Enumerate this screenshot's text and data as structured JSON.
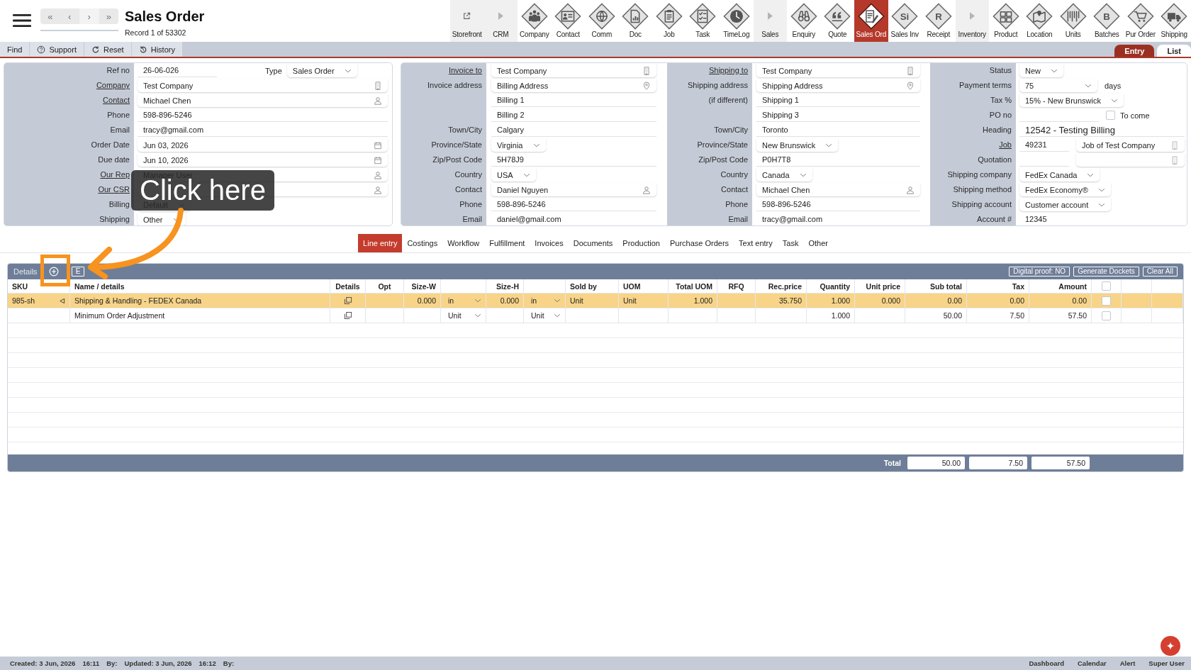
{
  "header": {
    "nav_buttons": [
      "«",
      "‹",
      "›",
      "»"
    ],
    "title": "Sales Order",
    "record": "Record 1 of 53302"
  },
  "modules": [
    {
      "label": "Storefront",
      "kind": "link",
      "selected": false
    },
    {
      "label": "CRM",
      "kind": "section",
      "selected": false
    },
    {
      "label": "Company",
      "kind": "module",
      "selected": false
    },
    {
      "label": "Contact",
      "kind": "module",
      "selected": false
    },
    {
      "label": "Comm",
      "kind": "module",
      "selected": false
    },
    {
      "label": "Doc",
      "kind": "module",
      "selected": false
    },
    {
      "label": "Job",
      "kind": "module",
      "selected": false
    },
    {
      "label": "Task",
      "kind": "module",
      "selected": false
    },
    {
      "label": "TimeLog",
      "kind": "module",
      "selected": false
    },
    {
      "label": "Sales",
      "kind": "section",
      "selected": false
    },
    {
      "label": "Enquiry",
      "kind": "module",
      "selected": false
    },
    {
      "label": "Quote",
      "kind": "module",
      "selected": false
    },
    {
      "label": "Sales Ord",
      "kind": "module",
      "selected": true
    },
    {
      "label": "Sales Inv",
      "kind": "module",
      "glyph": "Si",
      "selected": false
    },
    {
      "label": "Receipt",
      "kind": "module",
      "glyph": "R",
      "selected": false
    },
    {
      "label": "Inventory",
      "kind": "section",
      "selected": false
    },
    {
      "label": "Product",
      "kind": "module",
      "selected": false
    },
    {
      "label": "Location",
      "kind": "module",
      "selected": false
    },
    {
      "label": "Units",
      "kind": "module",
      "selected": false
    },
    {
      "label": "Batches",
      "kind": "module",
      "glyph": "B",
      "selected": false
    },
    {
      "label": "Pur Order",
      "kind": "module",
      "selected": false
    },
    {
      "label": "Shipping",
      "kind": "module",
      "selected": false
    }
  ],
  "toolbar": {
    "buttons": [
      "Find",
      "Support",
      "Reset",
      "History"
    ],
    "view_tabs": [
      {
        "label": "Entry",
        "selected": true
      },
      {
        "label": "List",
        "selected": false
      }
    ]
  },
  "form": {
    "panels": [
      {
        "sections": [
          {
            "rows": [
              {
                "label": "Ref no",
                "link": false,
                "value": "26-06-026",
                "kind": "text",
                "extra": {
                  "kind": "select",
                  "label": "Type",
                  "value": "Sales Order"
                }
              },
              {
                "label": "Company",
                "link": true,
                "value": "Test Company",
                "kind": "company"
              },
              {
                "label": "Contact",
                "link": true,
                "value": "Michael Chen",
                "kind": "person"
              },
              {
                "label": "Phone",
                "link": false,
                "value": "598-896-5246",
                "kind": "text"
              },
              {
                "label": "Email",
                "link": false,
                "value": "tracy@gmail.com",
                "kind": "text"
              },
              {
                "label": "Order Date",
                "link": false,
                "value": "Jun 03, 2026",
                "kind": "date"
              },
              {
                "label": "Due date",
                "link": false,
                "value": "Jun 10, 2026",
                "kind": "date"
              },
              {
                "label": "Our Rep",
                "link": true,
                "value": "Manager User",
                "kind": "person"
              },
              {
                "label": "Our CSR",
                "link": true,
                "kind": "person"
              },
              {
                "label": "Billing",
                "link": false,
                "value": "Default",
                "kind": "select"
              },
              {
                "label": "Shipping",
                "link": false,
                "value": "Other",
                "kind": "select"
              }
            ]
          }
        ]
      },
      {
        "sections": [
          {
            "rows": [
              {
                "label": "Invoice to",
                "link": true,
                "value": "Test Company",
                "kind": "company"
              },
              {
                "label": "Invoice address",
                "link": false,
                "value": "Billing Address",
                "kind": "address"
              },
              {
                "value": "Billing 1",
                "kind": "text"
              },
              {
                "value": "Billing 2",
                "kind": "text"
              },
              {
                "label": "Town/City",
                "link": false,
                "value": "Calgary",
                "kind": "text"
              },
              {
                "label": "Province/State",
                "link": false,
                "value": "Virginia",
                "kind": "select"
              },
              {
                "label": "Zip/Post Code",
                "link": false,
                "value": "5H78J9",
                "kind": "text"
              },
              {
                "label": "Country",
                "link": false,
                "value": "USA",
                "kind": "select"
              },
              {
                "label": "Contact",
                "link": false,
                "value": "Daniel Nguyen",
                "kind": "person"
              },
              {
                "label": "Phone",
                "link": false,
                "value": "598-896-5246",
                "kind": "text"
              },
              {
                "label": "Email",
                "link": false,
                "value": "daniel@gmail.com",
                "kind": "text"
              }
            ]
          },
          {
            "rows": [
              {
                "label": "Shipping to",
                "link": true,
                "value": "Test Company",
                "kind": "company"
              },
              {
                "label": "Shipping address",
                "link": false,
                "value": "Shipping Address",
                "kind": "address"
              },
              {
                "label": "(if different)",
                "link": false,
                "value": "Shipping 1",
                "kind": "text"
              },
              {
                "value": "Shipping 3",
                "kind": "text"
              },
              {
                "label": "Town/City",
                "link": false,
                "value": "Toronto",
                "kind": "text"
              },
              {
                "label": "Province/State",
                "link": false,
                "value": "New Brunswick",
                "kind": "select"
              },
              {
                "label": "Zip/Post Code",
                "link": false,
                "value": "P0H7T8",
                "kind": "text"
              },
              {
                "label": "Country",
                "link": false,
                "value": "Canada",
                "kind": "select"
              },
              {
                "label": "Contact",
                "link": false,
                "value": "Michael Chen",
                "kind": "person"
              },
              {
                "label": "Phone",
                "link": false,
                "value": "598-896-5246",
                "kind": "text"
              },
              {
                "label": "Email",
                "link": false,
                "value": "tracy@gmail.com",
                "kind": "text"
              }
            ]
          },
          {
            "rows": [
              {
                "label": "Status",
                "link": false,
                "value": "New",
                "kind": "select"
              },
              {
                "label": "Payment terms",
                "link": false,
                "value": "75",
                "kind": "select",
                "suffix": "days"
              },
              {
                "label": "Tax %",
                "link": false,
                "value": "15% - New Brunswick",
                "kind": "select"
              },
              {
                "label": "PO no",
                "link": false,
                "kind": "text",
                "extra": {
                  "kind": "checkbox",
                  "label": "To come",
                  "checked": false
                }
              },
              {
                "label": "Heading",
                "link": false,
                "value": "12542 - Testing Billing",
                "kind": "heading"
              },
              {
                "label": "Job",
                "link": true,
                "value": "49231",
                "kind": "text",
                "extra": {
                  "kind": "lookup",
                  "value": "Job of Test Company"
                }
              },
              {
                "label": "Quotation",
                "link": false,
                "kind": "text",
                "extra": {
                  "kind": "lookup"
                }
              },
              {
                "label": "Shipping company",
                "link": false,
                "value": "FedEx Canada",
                "kind": "select"
              },
              {
                "label": "Shipping method",
                "link": false,
                "value": "FedEx Economy®",
                "kind": "select"
              },
              {
                "label": "Shipping account",
                "link": false,
                "value": "Customer account",
                "kind": "select"
              },
              {
                "label": "Account #",
                "link": false,
                "value": "12345",
                "kind": "text"
              }
            ]
          }
        ]
      }
    ]
  },
  "tabs": [
    {
      "label": "Line entry",
      "selected": true
    },
    {
      "label": "Costings",
      "selected": false
    },
    {
      "label": "Workflow",
      "selected": false
    },
    {
      "label": "Fulfillment",
      "selected": false
    },
    {
      "label": "Invoices",
      "selected": false
    },
    {
      "label": "Documents",
      "selected": false
    },
    {
      "label": "Production",
      "selected": false
    },
    {
      "label": "Purchase Orders",
      "selected": false
    },
    {
      "label": "Text entry",
      "selected": false
    },
    {
      "label": "Task",
      "selected": false
    },
    {
      "label": "Other",
      "selected": false
    }
  ],
  "details": {
    "title": "Details",
    "left_buttons": [
      "E"
    ],
    "right_buttons": [
      "Digital proof: NO",
      "Generate Dockets",
      "Clear All"
    ],
    "columns": [
      "SKU",
      "Name / details",
      "Details",
      "Opt",
      "Size-W",
      "Size-H",
      "Sold by",
      "UOM",
      "Total UOM",
      "RFQ",
      "Rec.price",
      "Quantity",
      "Unit price",
      "Sub total",
      "Tax",
      "Amount"
    ],
    "all_checked": false,
    "rows": [
      {
        "selected": true,
        "checked": false,
        "sku": "985-sh",
        "name": "Shipping & Handling - FEDEX Canada",
        "size_w": "0.000",
        "size_w_unit": "in",
        "size_h": "0.000",
        "size_h_unit": "in",
        "sold_by": "Unit",
        "uom": "Unit",
        "total_uom": "1.000",
        "rec_price": "35.750",
        "quantity": "1.000",
        "unit_price": "0.000",
        "sub_total": "0.00",
        "tax": "0.00",
        "amount": "0.00"
      },
      {
        "selected": false,
        "checked": false,
        "name": "Minimum Order Adjustment",
        "size_w_unit": "Unit",
        "size_h_unit": "Unit",
        "quantity": "1.000",
        "sub_total": "50.00",
        "tax": "7.50",
        "amount": "57.50"
      }
    ],
    "totals": {
      "label": "Total",
      "sub_total": "50.00",
      "tax": "7.50",
      "amount": "57.50"
    }
  },
  "callout": {
    "text": "Click here"
  },
  "status_bar": {
    "left": [
      "Created: 3 Jun, 2026",
      "16:11",
      "By:",
      "Updated: 3 Jun, 2026",
      "16:12",
      "By:"
    ],
    "right": [
      "Dashboard",
      "Calendar",
      "Alert",
      "Super User"
    ]
  }
}
